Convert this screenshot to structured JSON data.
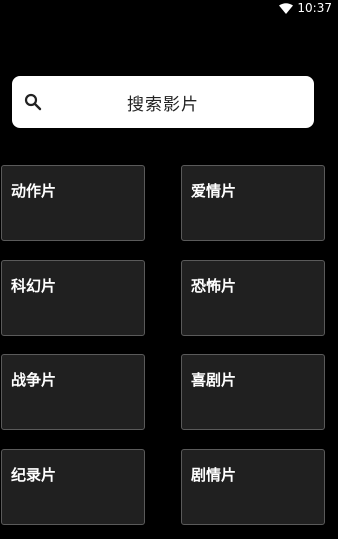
{
  "status_bar": {
    "time": "10:37",
    "wifi_icon": "wifi-icon"
  },
  "search": {
    "label": "搜索影片",
    "icon": "search-icon"
  },
  "categories": [
    {
      "label": "动作片"
    },
    {
      "label": "爱情片"
    },
    {
      "label": "科幻片"
    },
    {
      "label": "恐怖片"
    },
    {
      "label": "战争片"
    },
    {
      "label": "喜剧片"
    },
    {
      "label": "纪录片"
    },
    {
      "label": "剧情片"
    }
  ],
  "colors": {
    "background": "#000000",
    "tile_background": "#202020",
    "tile_border": "#5a5a5a",
    "search_background": "#ffffff"
  }
}
